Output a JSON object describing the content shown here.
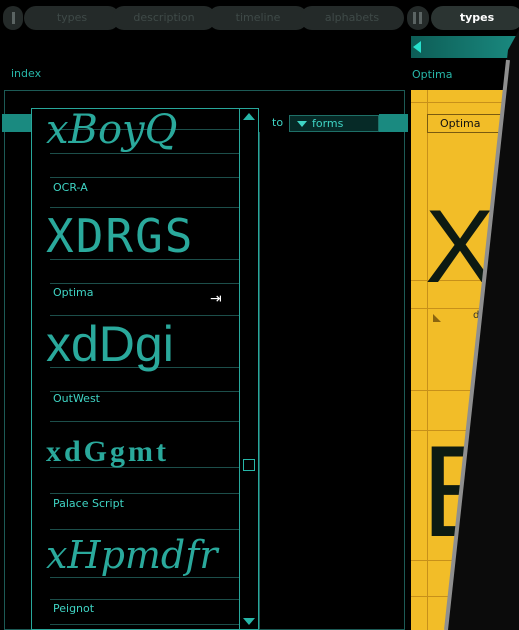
{
  "top_tabs": {
    "items": [
      "types",
      "description",
      "timeline",
      "alphabets"
    ],
    "active_right": "types"
  },
  "index_panel": {
    "title": "index",
    "to_label": "to",
    "forms_select": "forms",
    "fonts": [
      {
        "name": "OCR-A",
        "sample": "XDRGS"
      },
      {
        "name": "Optima",
        "sample": "xdDgi"
      },
      {
        "name": "OutWest",
        "sample": "xdGgmt"
      },
      {
        "name": "Palace Script",
        "sample": "xHpmdfr"
      },
      {
        "name": "Peignot",
        "sample": ""
      }
    ],
    "top_sample": "xBoyQ"
  },
  "detail_panel": {
    "title": "Optima",
    "field_value": "Optima",
    "big_letters": [
      "X",
      "E"
    ],
    "small_text": "d"
  },
  "colors": {
    "accent": "#27b6a8",
    "panel_yellow": "#f2bd28",
    "background": "#000000"
  }
}
